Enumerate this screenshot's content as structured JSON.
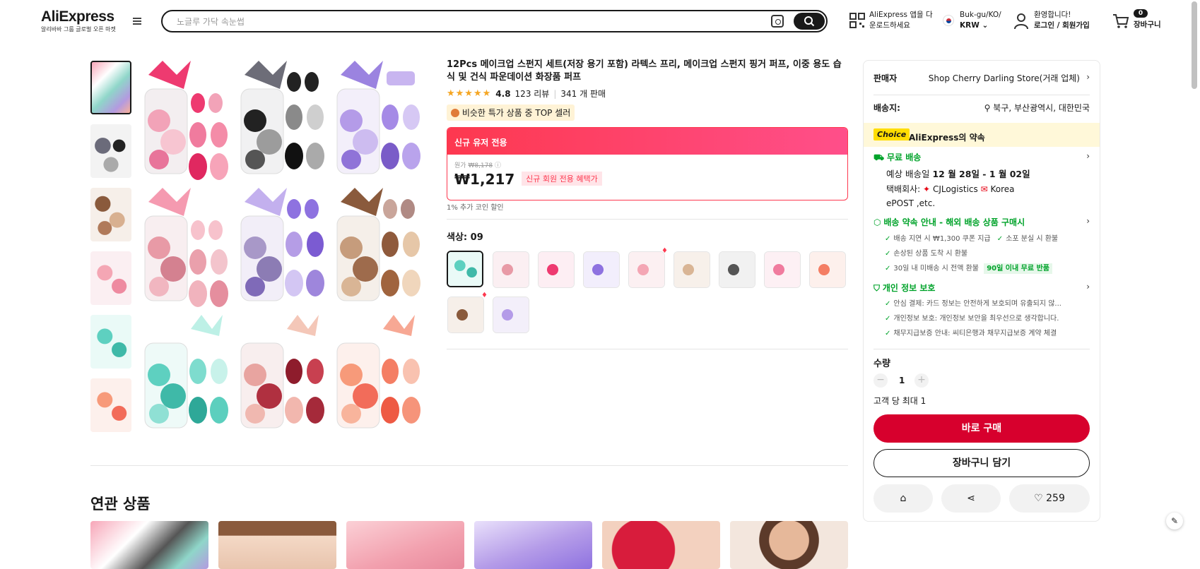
{
  "header": {
    "logo": "AliExpress",
    "logo_sub": "알리바바 그룹 글로벌 오픈 마켓",
    "search_placeholder": "노글루 가닥 속눈썹",
    "app_line1": "AliExpress 앱을 다",
    "app_line2": "운로드하세요",
    "region_line1": "Buk-gu/KO/",
    "region_line2": "KRW",
    "account_line1": "환영합니다!",
    "account_line2": "로그인 / 회원가입",
    "cart_count": "0",
    "cart_label": "장바구니"
  },
  "product": {
    "title": "12Pcs 메이크업 스펀지 세트(저장 용기 포함) 라텍스 프리, 메이크업 스펀지 핑거 퍼프, 이중 용도 습식 및 건식 파운데이션 화장품 퍼프",
    "stars": "★★★★★",
    "rating": "4.8",
    "reviews": "123 리뷰",
    "sold": "341 개 판매",
    "top_seller": "비슷한 특가 상품 중 TOP 셀러",
    "promo_header": "신규 유저 전용",
    "original_label": "원가",
    "original_price": "₩8,178",
    "price": "₩1,217",
    "new_member_tag": "신규 회원 전용 혜택가",
    "coin_discount": "1% 추가 코인 할인",
    "color_label": "색상: 09"
  },
  "related": {
    "title": "연관 상품"
  },
  "panel": {
    "seller_label": "판매자",
    "seller_name": "Shop Cherry Darling Store(거래 업체)",
    "ship_to_label": "배송지:",
    "ship_to": "북구, 부산광역시, 대한민국",
    "choice_tag": "Choice",
    "choice_promise": "AliExpress의 약속",
    "free_shipping": "무료 배송",
    "delivery_prefix": "예상 배송일 ",
    "delivery_dates": "12 월 28일 - 1 월 02일",
    "carrier_label": "택배회사:",
    "carrier1": "CJLogistics",
    "carrier2": "Korea",
    "carrier3": "ePOST ,etc.",
    "guarantee_title": "배송 약속 안내 - 해외 배송 상품 구매시",
    "guarantee_1": "배송 지연 시 ₩1,300 쿠폰 지급",
    "guarantee_2": "소포 분실 시 환불",
    "guarantee_3": "손상된 상품 도착 시 환불",
    "guarantee_4": "30일 내 미배송 시 전액 환불",
    "guarantee_badge": "90일 이내 무료 반품",
    "privacy_title": "개인 정보 보호",
    "privacy_1": "안심 결제: 카드 정보는 안전하게 보호되며 유출되지 않...",
    "privacy_2": "개인정보 보호: 개인정보 보안을 최우선으로 생각합니다.",
    "privacy_3": "채무지급보증 안내: 씨티은행과 채무지급보증 계약 체결",
    "qty_label": "수량",
    "qty_value": "1",
    "qty_limit": "고객 당 최대 1",
    "buy_now": "바로 구매",
    "add_to_cart": "장바구니 담기",
    "wishlist_count": "259"
  }
}
